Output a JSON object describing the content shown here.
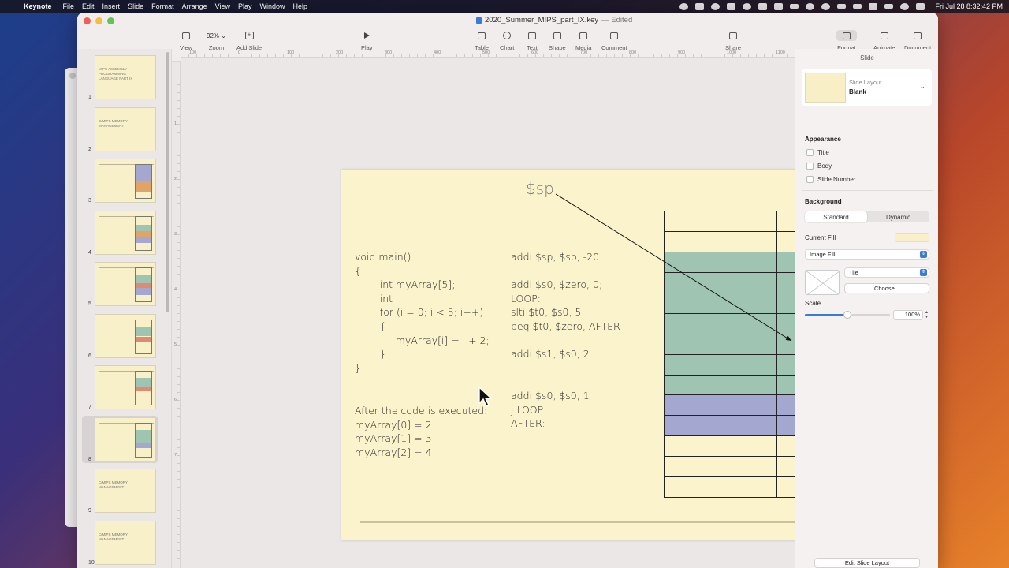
{
  "menubar": {
    "apple": "",
    "items": [
      "Keynote",
      "File",
      "Edit",
      "Insert",
      "Slide",
      "Format",
      "Arrange",
      "View",
      "Play",
      "Window",
      "Help"
    ],
    "clock": "Fri Jul 28  8:32:42 PM"
  },
  "window": {
    "doc_title": "2020_Summer_MIPS_part_IX.key",
    "edited_label": "— Edited"
  },
  "toolbar": {
    "view": "View",
    "zoom_value": "92%",
    "zoom": "Zoom",
    "add_slide": "Add Slide",
    "play": "Play",
    "table": "Table",
    "chart": "Chart",
    "text": "Text",
    "shape": "Shape",
    "media": "Media",
    "comment": "Comment",
    "share": "Share",
    "format": "Format",
    "animate": "Animate",
    "document": "Document"
  },
  "rulers": {
    "h": [
      "100",
      "0",
      "100",
      "200",
      "300",
      "400",
      "500",
      "600",
      "700",
      "800",
      "900",
      "1000",
      "1100"
    ],
    "v": [
      "1",
      "2",
      "3",
      "4",
      "5",
      "6",
      "7"
    ]
  },
  "navigator": {
    "slides": [
      {
        "num": "1",
        "caption": "MIPS ASSEMBLY PROGRAMMING LANGUAGE PART IX"
      },
      {
        "num": "2",
        "caption": "C/MIPS MEMORY MANAGEMENT"
      },
      {
        "num": "3",
        "caption": ""
      },
      {
        "num": "4",
        "caption": ""
      },
      {
        "num": "5",
        "caption": ""
      },
      {
        "num": "6",
        "caption": ""
      },
      {
        "num": "7",
        "caption": ""
      },
      {
        "num": "8",
        "caption": ""
      },
      {
        "num": "9",
        "caption": "C/MIPS MEMORY MANAGEMENT"
      },
      {
        "num": "10",
        "caption": "C/MIPS MEMORY MANAGEMENT"
      }
    ],
    "selected": "8"
  },
  "slide": {
    "sp_label": "$sp",
    "c_code": "void main()\n{\n        int myArray[5];\n        int i;\n        for (i = 0; i < 5; i++)\n        {\n             myArray[i] = i + 2;\n        }\n}",
    "after_text": "After the code is executed:\nmyArray[0] = 2\nmyArray[1] = 3\nmyArray[2] = 4\n...",
    "mips_code": "addi $sp, $sp, -20\n\naddi $s0, $zero, 0;\nLOOP:\nslti $t0, $s0, 5\nbeq $t0, $zero, AFTER\n\naddi $s1, $s0, 2\n\n\naddi $s0, $s0, 1\nj LOOP\nAFTER:",
    "memory_grid": {
      "rows": 14,
      "cols": 4,
      "row_colors": [
        "none",
        "none",
        "teal",
        "teal",
        "teal",
        "teal",
        "teal",
        "teal",
        "teal",
        "purple",
        "purple",
        "none",
        "none",
        "none"
      ]
    },
    "colors": {
      "background": "#fbf3cc",
      "teal": "#9fc4b2",
      "purple": "#a4a7cf",
      "line": "#c9c1a2"
    }
  },
  "inspector": {
    "header": "Slide",
    "slide_layout_label": "Slide Layout",
    "slide_layout_value": "Blank",
    "appearance": "Appearance",
    "title": "Title",
    "body": "Body",
    "slide_number": "Slide Number",
    "background": "Background",
    "standard": "Standard",
    "dynamic": "Dynamic",
    "current_fill": "Current Fill",
    "image_fill": "Image Fill",
    "tile": "Tile",
    "choose": "Choose...",
    "scale": "Scale",
    "scale_value": "100%",
    "scale_fraction": 0.5,
    "edit_slide_layout": "Edit Slide Layout"
  }
}
